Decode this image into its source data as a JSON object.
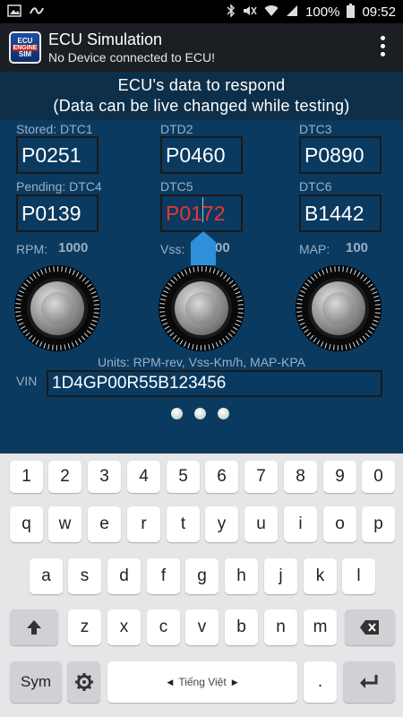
{
  "status": {
    "battery": "100%",
    "time": "09:52"
  },
  "app": {
    "logo": [
      "ECU",
      "ENGINE",
      "SIM"
    ],
    "title": "ECU Simulation",
    "subtitle": "No Device connected to ECU!"
  },
  "banner": {
    "line1": "ECU's data to respond",
    "line2": "(Data can be live changed while testing)"
  },
  "dtcs": [
    {
      "label": "Stored: DTC1",
      "value": "P0251"
    },
    {
      "label": "DTD2",
      "value": "P0460"
    },
    {
      "label": "DTC3",
      "value": "P0890"
    },
    {
      "label": "Pending: DTC4",
      "value": "P0139"
    },
    {
      "label": "DTC5",
      "value": "P0172"
    },
    {
      "label": "DTC6",
      "value": "B1442"
    }
  ],
  "gauges": [
    {
      "label": "RPM:",
      "value": "1000"
    },
    {
      "label": "Vss:",
      "value": "00"
    },
    {
      "label": "MAP:",
      "value": "100"
    }
  ],
  "units": "Units: RPM-rev, Vss-Km/h, MAP-KPA",
  "vin": {
    "label": "VIN",
    "value": "1D4GP00R55B123456"
  },
  "keyboard": {
    "numbers": [
      "1",
      "2",
      "3",
      "4",
      "5",
      "6",
      "7",
      "8",
      "9",
      "0"
    ],
    "row1": [
      "q",
      "w",
      "e",
      "r",
      "t",
      "y",
      "u",
      "i",
      "o",
      "p"
    ],
    "row2": [
      "a",
      "s",
      "d",
      "f",
      "g",
      "h",
      "j",
      "k",
      "l"
    ],
    "row3": [
      "z",
      "x",
      "c",
      "v",
      "b",
      "n",
      "m"
    ],
    "sym": "Sym",
    "space": "Tiếng Việt",
    "period": "."
  },
  "colors": {
    "background": "#0a3a60",
    "active_text": "#e33333",
    "handle": "#2f8fd8"
  }
}
